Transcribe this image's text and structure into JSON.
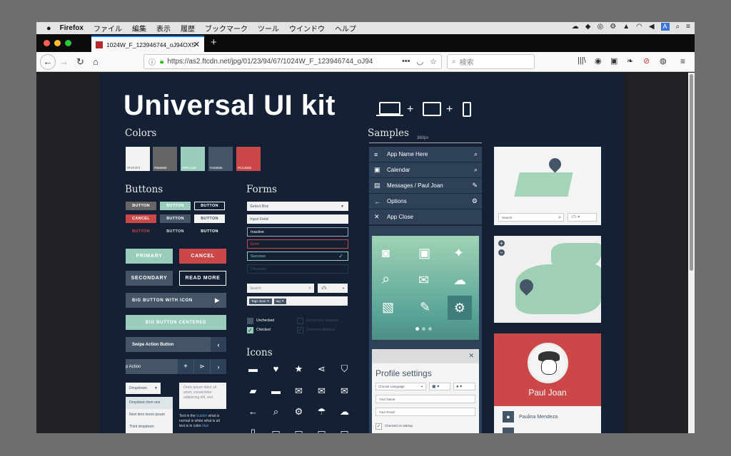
{
  "menubar": {
    "app": "Firefox",
    "items": [
      "ファイル",
      "編集",
      "表示",
      "履歴",
      "ブックマーク",
      "ツール",
      "ウインドウ",
      "ヘルプ"
    ],
    "input_badge": "A"
  },
  "tab": {
    "title": "1024W_F_123946744_oJ94OX5"
  },
  "address": {
    "url": "https://as2.ftcdn.net/jpg/01/23/94/67/1024W_F_123946744_oJ94",
    "search_placeholder": "検索"
  },
  "kit": {
    "title": "Universal UI kit",
    "colors_heading": "Colors",
    "swatches": [
      {
        "label": "#F2F2F2",
        "color": "#f2f2f2"
      },
      {
        "label": "#666666",
        "color": "#666666"
      },
      {
        "label": "#99CCBB",
        "color": "#99ccbb"
      },
      {
        "label": "#445566",
        "color": "#445566"
      },
      {
        "label": "#CC4848",
        "color": "#cc4848"
      }
    ],
    "buttons_heading": "Buttons",
    "small_buttons": [
      "BUTTON",
      "BUTTON",
      "BUTTON",
      "CANCEL",
      "BUTTON",
      "BUTTON",
      "BUTTON",
      "BUTTON",
      "BUTTON"
    ],
    "primary": "PRIMARY",
    "cancel": "CANCEL",
    "secondary": "SECONDARY",
    "read_more": "READ MORE",
    "big_icon": "BIG BUTTON WITH ICON",
    "big_centered": "BIG BUTTON CENTERED",
    "swipe": "Swipe Action Button",
    "swipe_action": "p Action",
    "dropdown": "Dropdown",
    "dropdown_items": [
      "Dropdown item one",
      "Next item lorem ipsum",
      "Third dropdown"
    ],
    "lorem": "Orem ipsum dolor sit amet, consectetur adipiscing elit, sed",
    "text_in": "Text in the",
    "text_bubble": "bubble",
    "text_rest": "what is normal is white what is alt text is in color",
    "text_blue": "blue",
    "forms_heading": "Forms",
    "select_box": "Select Box",
    "input_field": "Input Field",
    "inactive": "Inactive",
    "error": "Error",
    "success": "Success",
    "disabled": "Disabled",
    "search": "Search",
    "tags": [
      "Tags input",
      "tag"
    ],
    "unchecked": "Unchecked",
    "checked": "Checked",
    "unchecked_disabled": "Unchecked disabled",
    "checked_disabled": "Checked disabled",
    "icons_heading": "Icons",
    "samples_heading": "Samples",
    "width_label": "360px",
    "nav_items": [
      "App Name Here",
      "Calendar",
      "Messages / Paul Joan",
      "Options",
      "App Close"
    ],
    "map_search": "Search",
    "profile_title": "Profile settings",
    "choose_language": "Choose Language",
    "your_name": "Your Name",
    "your_email": "Your Email",
    "checked_on_startup": "Checked on startup",
    "contact_name": "Paul Joan",
    "contact_item": "Paulina Mendeza"
  }
}
